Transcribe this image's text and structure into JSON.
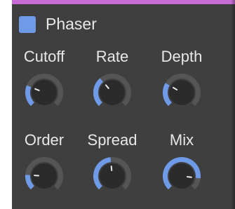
{
  "panel": {
    "title": "Phaser",
    "enabled": true,
    "accent_color": "#c96dd6",
    "toggle_color": "#6f9ae8"
  },
  "knobs": [
    {
      "id": "cutoff",
      "label": "Cutoff",
      "value": 0.25
    },
    {
      "id": "rate",
      "label": "Rate",
      "value": 0.35
    },
    {
      "id": "depth",
      "label": "Depth",
      "value": 0.28
    },
    {
      "id": "order",
      "label": "Order",
      "value": 0.18
    },
    {
      "id": "spread",
      "label": "Spread",
      "value": 0.48
    },
    {
      "id": "mix",
      "label": "Mix",
      "value": 0.86
    }
  ],
  "colors": {
    "arc_active": "#6f9ae8",
    "arc_track": "#555555",
    "knob_body": "#2b2b2b",
    "pointer": "#e8e8e8"
  }
}
